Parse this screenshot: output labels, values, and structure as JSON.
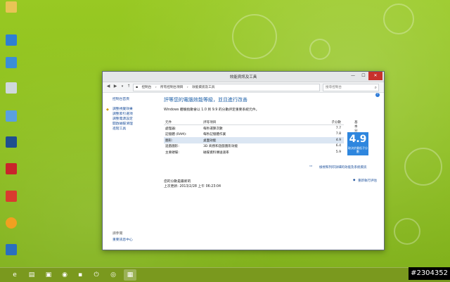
{
  "window": {
    "title": "效能資訊及工具",
    "address": [
      "控制台",
      "所有控制台項目",
      "效能資訊及工具"
    ],
    "search_placeholder": "搜尋控制台"
  },
  "sidebar": {
    "home": "控制台首頁",
    "items": [
      "調整視覺效果",
      "調整索引選項",
      "調整電源設定",
      "開啟磁碟清理",
      "進階工具"
    ],
    "see_also_title": "請參閱",
    "see_also_link": "重要訊息中心"
  },
  "main": {
    "heading": "評等您的電腦效能等級，並且進行改善",
    "subtitle": "Windows 體驗指數會以 1.0 到 9.9 的分數評定重要系統元件。",
    "headers": {
      "component": "元件",
      "rated": "評等項目",
      "subscore": "子分數",
      "base": "基本分數"
    },
    "rows": [
      {
        "component": "處理器:",
        "rated": "每秒運算次數",
        "subscore": "7.7"
      },
      {
        "component": "記憶體 (RAM):",
        "rated": "每秒記憶體作業",
        "subscore": "7.8"
      },
      {
        "component": "圖形:",
        "rated": "桌面效能",
        "subscore": "4.9"
      },
      {
        "component": "遊戲圖形:",
        "rated": "3D 商務和遊戲圖形效能",
        "subscore": "6.4"
      },
      {
        "component": "主要硬碟:",
        "rated": "磁碟資料傳送速率",
        "subscore": "5.9"
      }
    ],
    "base_score": "4.9",
    "base_caption": "取決於最低子分數",
    "link_details": "檢視和列印詳細的效能及系統資訊",
    "link_rerun": "重新執行評估",
    "note_current": "您的分數是最新的",
    "note_updated": "上次更新: 2013/2/28 上午 06:23:04"
  },
  "taskbar": {
    "watermark": "#2304352"
  }
}
